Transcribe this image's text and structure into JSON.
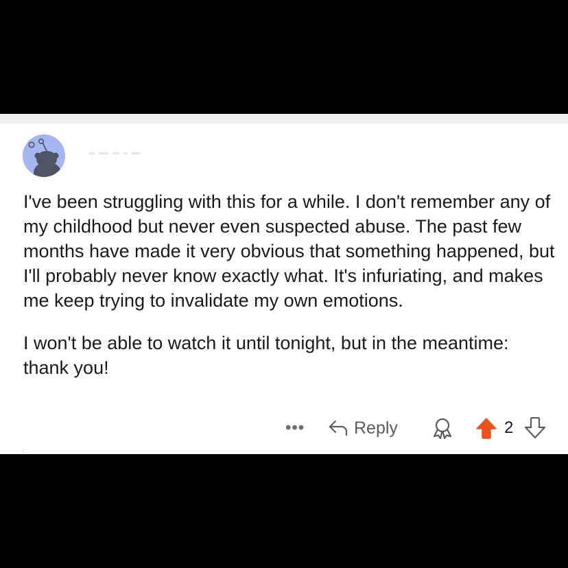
{
  "comment": {
    "paragraphs": [
      "I've been struggling with this for a while. I don't remember any of my childhood but never even suspected abuse. The past few months have made it very obvious that something happened, but I'll probably never know exactly what. It's infuriating, and makes me keep trying to invalidate my own emotions.",
      "I won't be able to watch it until tonight, but in the meantime: thank you!"
    ]
  },
  "actions": {
    "more_label": "•••",
    "reply_label": "Reply",
    "score": "2"
  },
  "icons": {
    "avatar": "reddit-snoo-avatar-icon",
    "reply": "reply-arrow-icon",
    "award": "award-icon",
    "upvote": "upvote-arrow-icon",
    "downvote": "downvote-arrow-icon"
  },
  "colors": {
    "upvote_active": "#e8541f",
    "avatar_bg": "#a5b6f0",
    "text": "#1a1a1b",
    "muted": "#5c5c5c"
  }
}
